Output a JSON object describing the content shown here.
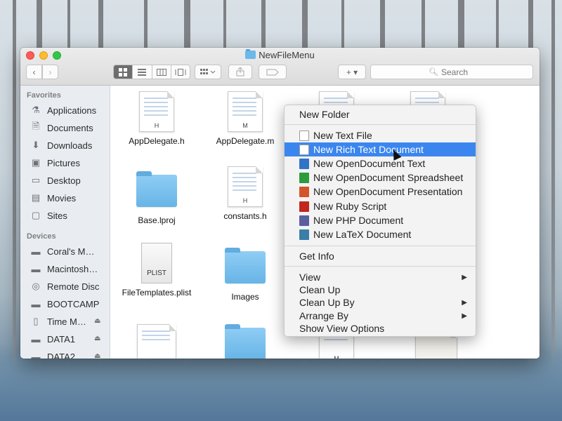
{
  "window": {
    "title": "NewFileMenu"
  },
  "toolbar": {
    "back": "‹",
    "forward": "›",
    "search_placeholder": "Search",
    "action_label": "+ ▾"
  },
  "sidebar": {
    "favorites_header": "Favorites",
    "favorites": [
      {
        "label": "Applications",
        "icon": "applications-icon"
      },
      {
        "label": "Documents",
        "icon": "documents-icon"
      },
      {
        "label": "Downloads",
        "icon": "downloads-icon"
      },
      {
        "label": "Pictures",
        "icon": "pictures-icon"
      },
      {
        "label": "Desktop",
        "icon": "desktop-icon"
      },
      {
        "label": "Movies",
        "icon": "movies-icon"
      },
      {
        "label": "Sites",
        "icon": "sites-icon"
      }
    ],
    "devices_header": "Devices",
    "devices": [
      {
        "label": "Coral's M…",
        "icon": "computer-icon"
      },
      {
        "label": "Macintosh…",
        "icon": "disk-icon"
      },
      {
        "label": "Remote Disc",
        "icon": "remote-disc-icon"
      },
      {
        "label": "BOOTCAMP",
        "icon": "disk-icon"
      },
      {
        "label": "Time M…",
        "icon": "time-machine-icon"
      },
      {
        "label": "DATA1",
        "icon": "disk-icon"
      },
      {
        "label": "DATA2",
        "icon": "disk-icon"
      }
    ]
  },
  "files": [
    {
      "name": "AppDelegate.h",
      "type": "doc",
      "letter": "H"
    },
    {
      "name": "AppDelegate.m",
      "type": "doc",
      "letter": "M"
    },
    {
      "name": "Base.lproj",
      "type": "folder"
    },
    {
      "name": "constants.h",
      "type": "doc",
      "letter": "H"
    },
    {
      "name": "FileTemplates.plist",
      "type": "plist",
      "badge": "PLIST"
    },
    {
      "name": "Images",
      "type": "folder"
    }
  ],
  "partial_files": [
    {
      "letter": "M"
    }
  ],
  "context_menu": {
    "new_folder": "New Folder",
    "items": [
      {
        "label": "New Text File",
        "icon": "text-file-icon"
      },
      {
        "label": "New Rich Text Document",
        "icon": "rtf-icon",
        "highlighted": true
      },
      {
        "label": "New OpenDocument Text",
        "icon": "odt-icon"
      },
      {
        "label": "New OpenDocument Spreadsheet",
        "icon": "ods-icon"
      },
      {
        "label": "New OpenDocument Presentation",
        "icon": "odp-icon"
      },
      {
        "label": "New Ruby Script",
        "icon": "ruby-icon"
      },
      {
        "label": "New PHP Document",
        "icon": "php-icon"
      },
      {
        "label": "New LaTeX Document",
        "icon": "latex-icon"
      }
    ],
    "get_info": "Get Info",
    "view": "View",
    "clean_up": "Clean Up",
    "clean_up_by": "Clean Up By",
    "arrange_by": "Arrange By",
    "show_view_options": "Show View Options"
  },
  "colors": {
    "highlight": "#3b86ee",
    "folder": "#6cb8ea",
    "close": "#fc5b57",
    "minimize": "#fdbc2e",
    "maximize": "#33c748"
  }
}
